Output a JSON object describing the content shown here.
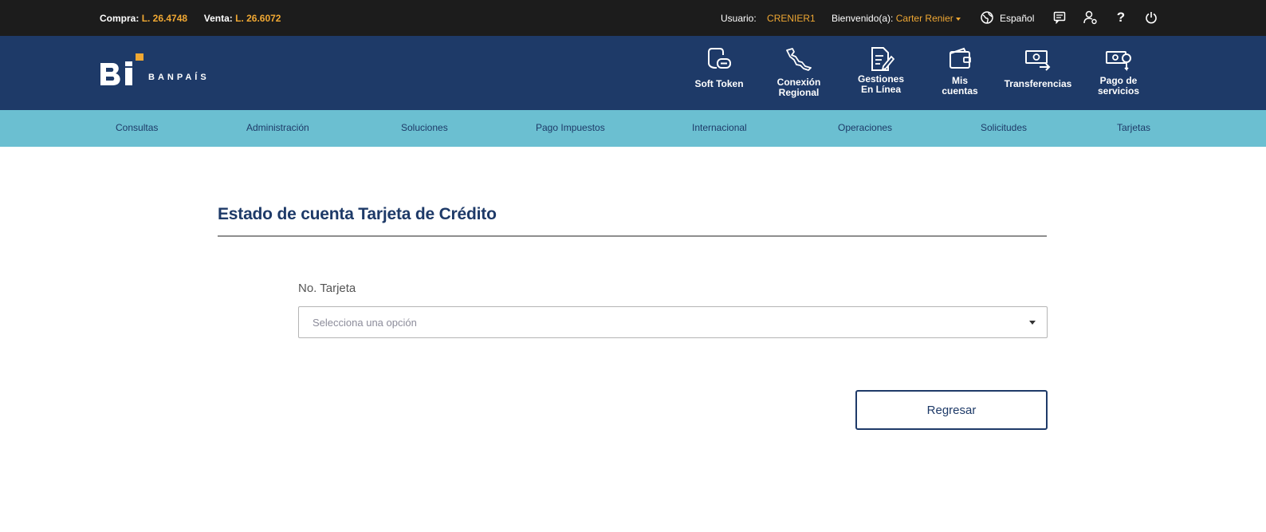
{
  "topbar": {
    "compra_label": "Compra:",
    "compra_value": "L. 26.4748",
    "venta_label": "Venta:",
    "venta_value": "L. 26.6072",
    "usuario_label": "Usuario:",
    "usuario_value": "CRENIER1",
    "bienvenido_label": "Bienvenido(a):",
    "bienvenido_value": "Carter Renier",
    "language": "Español",
    "icons": [
      "globe-icon",
      "messages-icon",
      "user-settings-icon",
      "help-icon",
      "power-icon"
    ]
  },
  "header": {
    "logo_text": "BANPAÍS",
    "quick_links": [
      {
        "line1": "Soft Token",
        "line2": "",
        "icon": "soft-token-icon"
      },
      {
        "line1": "Conexión",
        "line2": "Regional",
        "icon": "map-region-icon"
      },
      {
        "line1": "Gestiones",
        "line2": "En Línea",
        "icon": "document-edit-icon"
      },
      {
        "line1": "Mis",
        "line2": "cuentas",
        "icon": "wallet-icon"
      },
      {
        "line1": "Transferencias",
        "line2": "",
        "icon": "money-transfer-icon"
      },
      {
        "line1": "Pago de",
        "line2": "servicios",
        "icon": "service-payment-icon"
      }
    ]
  },
  "nav": {
    "items": [
      "Consultas",
      "Administración",
      "Soluciones",
      "Pago Impuestos",
      "Internacional",
      "Operaciones",
      "Solicitudes",
      "Tarjetas"
    ]
  },
  "main": {
    "title": "Estado de cuenta Tarjeta de Crédito",
    "card_label": "No. Tarjeta",
    "card_placeholder": "Selecciona una opción",
    "back_button": "Regresar"
  },
  "colors": {
    "topbar_bg": "#1c1c1c",
    "header_bg": "#1e3a68",
    "nav_bg": "#6bbfd1",
    "accent": "#f0a833"
  }
}
